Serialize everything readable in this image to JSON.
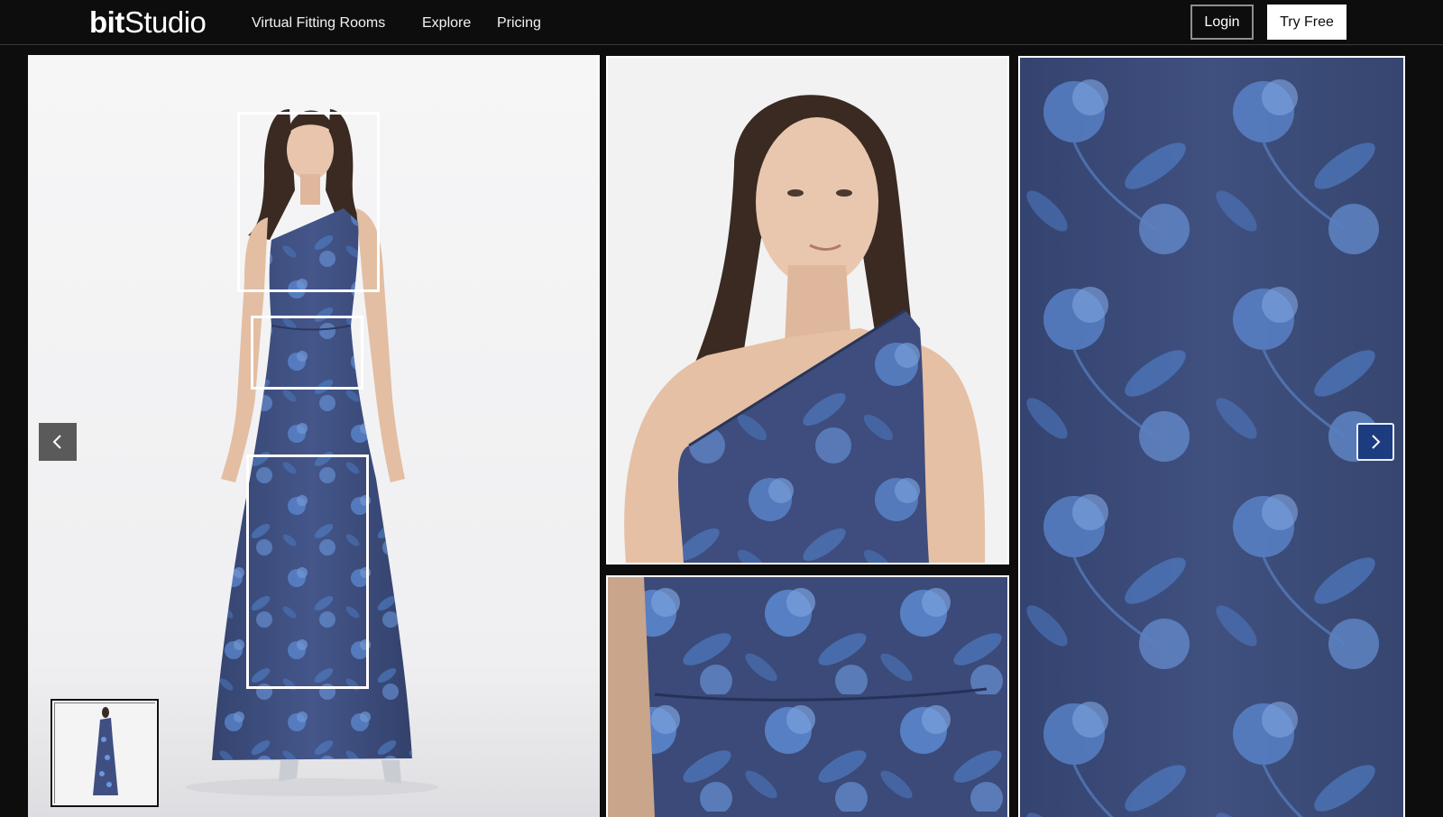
{
  "header": {
    "logo_bold": "bit",
    "logo_light": "Studio",
    "nav": [
      "Virtual Fitting Rooms",
      "Explore",
      "Pricing"
    ],
    "login_label": "Login",
    "try_free_label": "Try Free"
  },
  "gallery": {
    "main_image": "full-length model in blue floral one-shoulder gown",
    "detail_images": [
      "close-up upper body",
      "close-up waist detail",
      "close-up fabric print"
    ],
    "crop_boxes": 3,
    "thumbnails": 1
  },
  "icons": {
    "prev": "chevron-left-icon",
    "next": "chevron-right-icon"
  },
  "colors": {
    "background": "#0d0d0e",
    "dress_navy": "#3b4a78",
    "print_blue": "#5b8ad6",
    "next_button": "#1d3c7f"
  }
}
